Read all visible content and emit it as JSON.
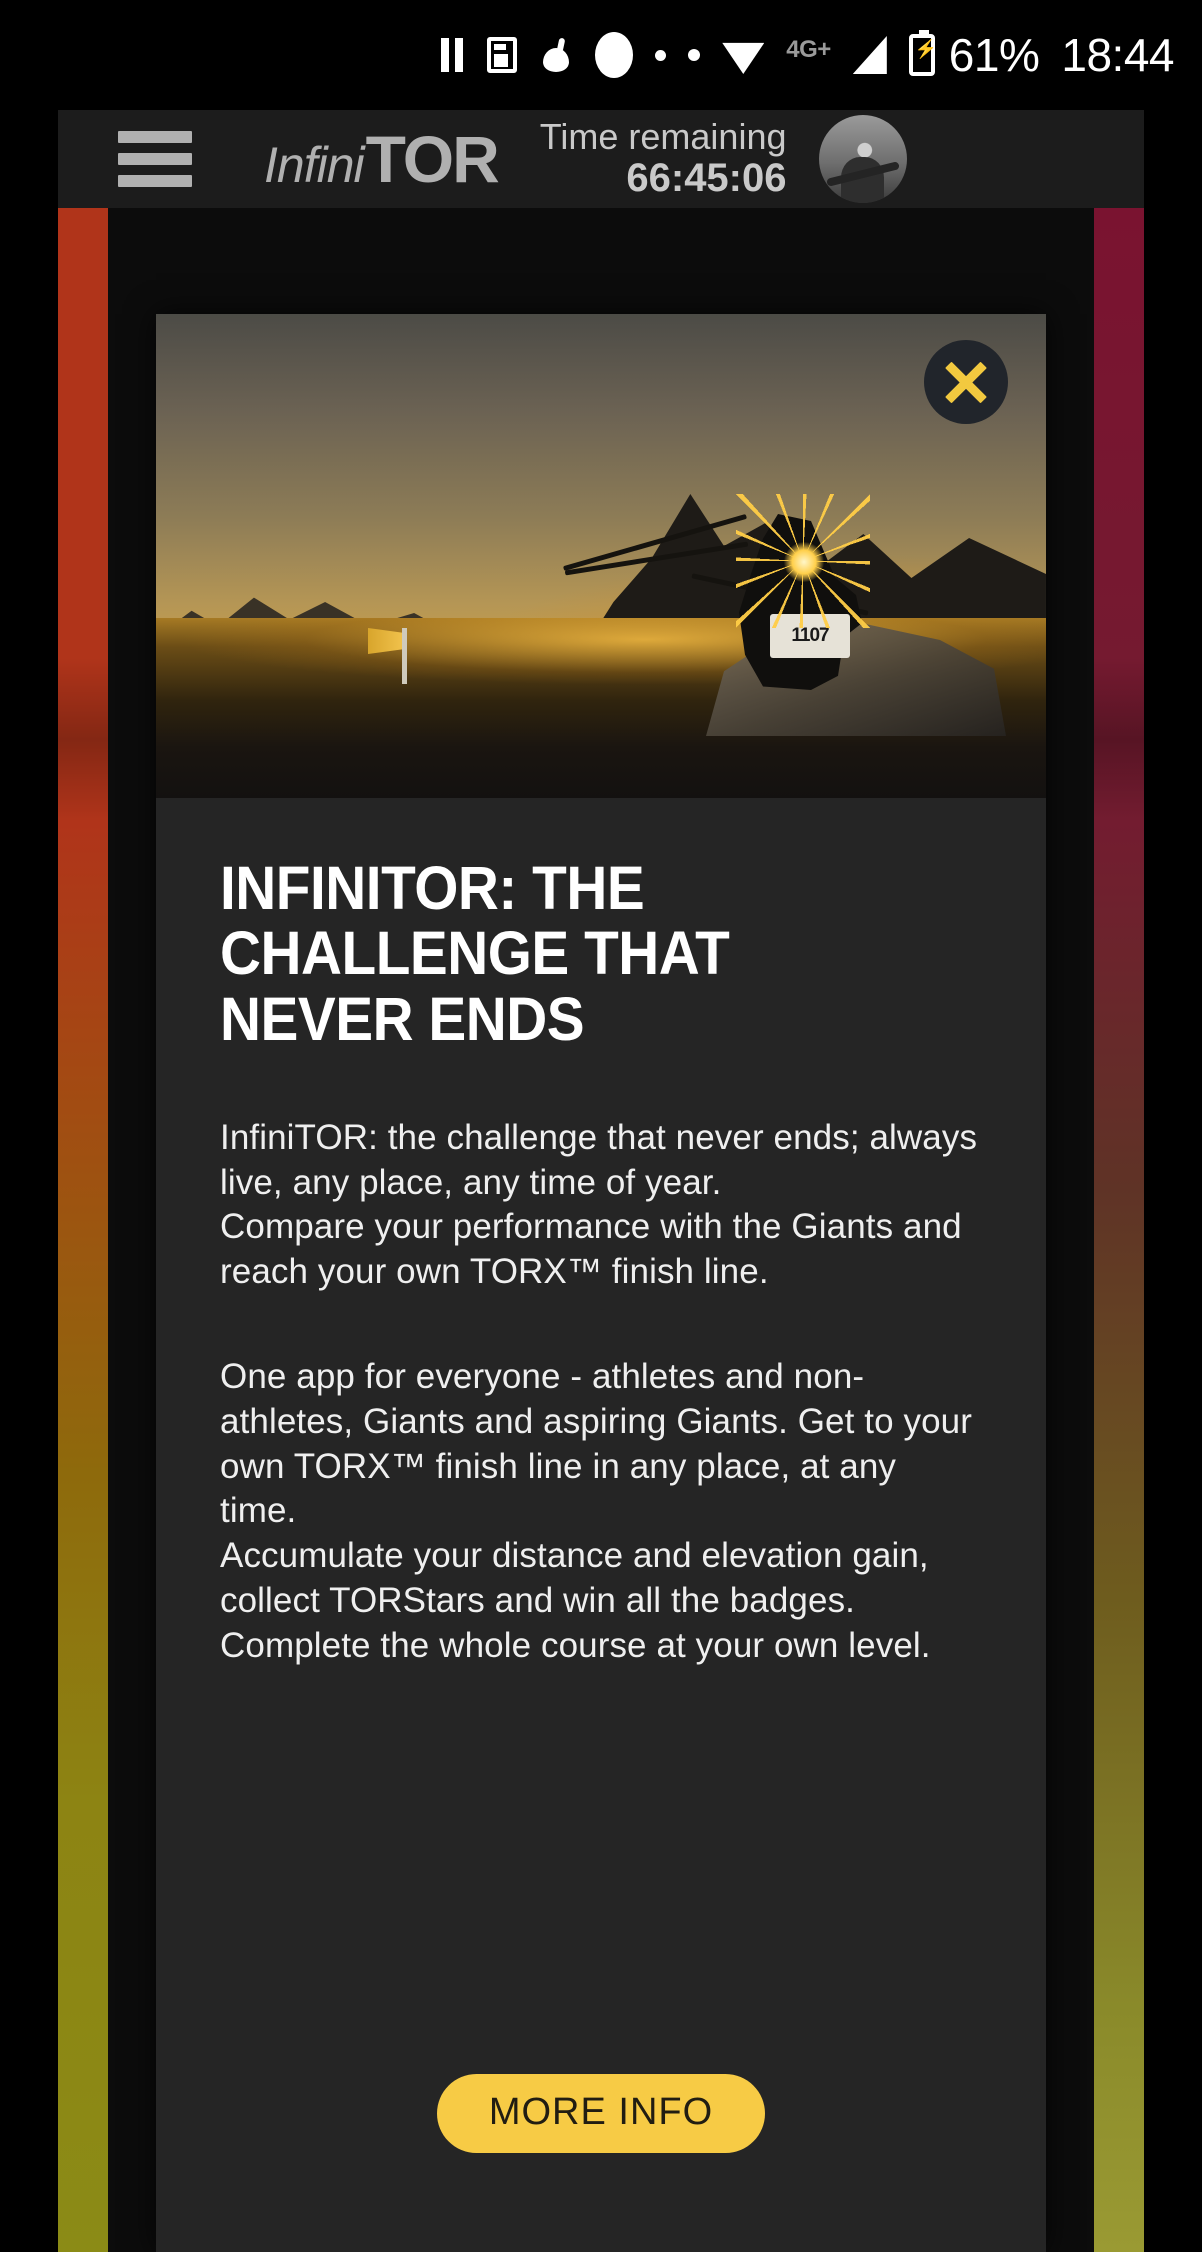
{
  "status_bar": {
    "icons": [
      "pause-icon",
      "news-feed-icon",
      "health-icon",
      "oval-icon",
      "dot-icon",
      "dot-icon",
      "wifi-icon",
      "cellular-signal-icon",
      "battery-charging-icon"
    ],
    "network_label": "4G+",
    "battery_percent": "61%",
    "clock": "18:44"
  },
  "app_bar": {
    "menu_icon": "hamburger-menu-icon",
    "logo_light": "Infini",
    "logo_bold": "TOR",
    "timer_label": "Time remaining",
    "timer_value": "66:45:06",
    "avatar": "user-avatar"
  },
  "modal": {
    "close_icon": "close-icon",
    "hero_image_alt": "trail runner at sunrise on mountain ridge",
    "bib_number": "1107",
    "title": "INFINITOR: THE CHALLENGE THAT NEVER ENDS",
    "paragraph_1": "InfiniTOR: the challenge that never ends; always live, any place, any time of year.\nCompare your performance with the Giants and reach your own TORX™ finish line.",
    "paragraph_2": "One app for everyone - athletes and non-athletes, Giants and aspiring Giants.  Get to your own TORX™ finish line in any place, at any time.\nAccumulate your distance and elevation gain, collect TORStars and win all the badges.\nComplete the whole course at your own level.",
    "more_info_label": "MORE INFO"
  },
  "colors": {
    "accent_yellow": "#f7cb45",
    "close_x": "#f2c93f",
    "modal_bg": "#252525",
    "app_bar_bg": "#1c1c1c",
    "strip_left_top": "#b0341a",
    "strip_left_bottom": "#8b8b16",
    "strip_right_top": "#7a1330",
    "strip_right_bottom": "#9a9a33"
  }
}
